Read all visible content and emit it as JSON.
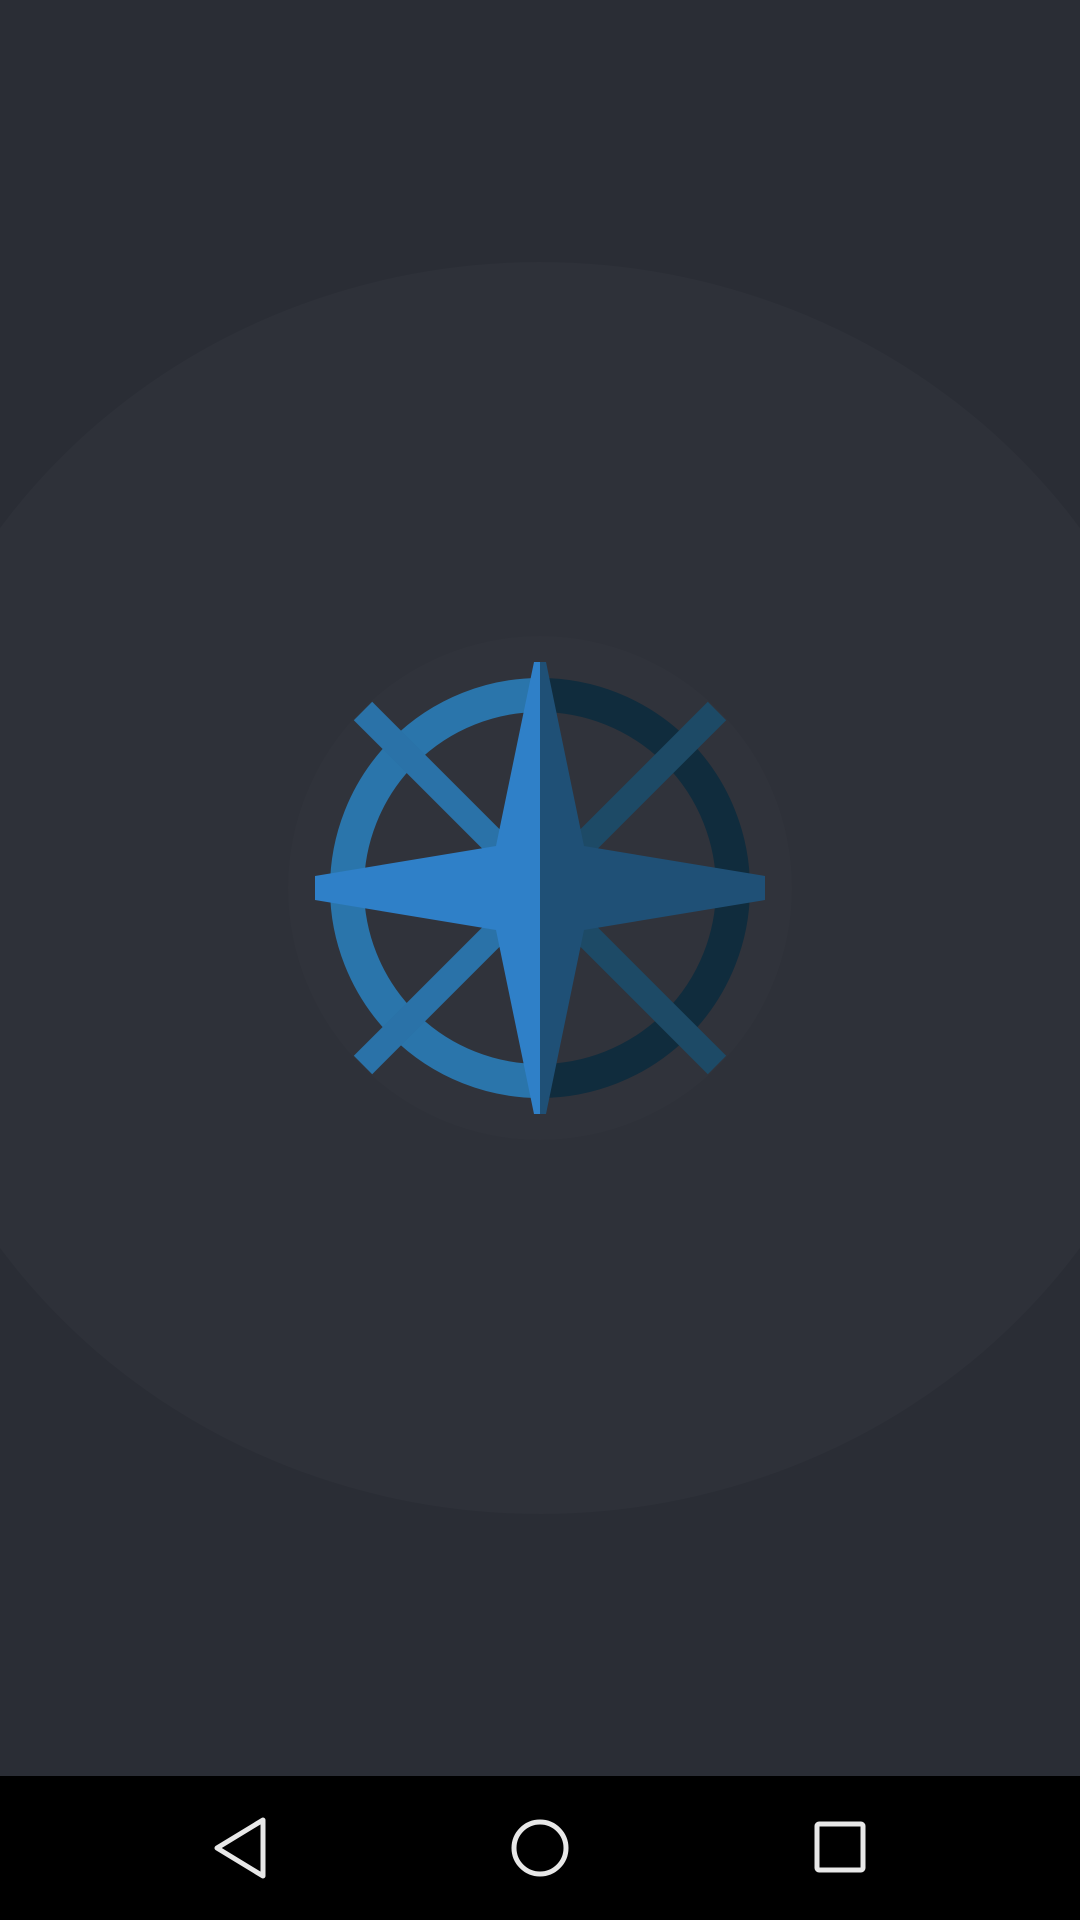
{
  "app": {
    "screen": "splash",
    "logo_icon": "compass-rose-icon"
  },
  "colors": {
    "background": "#2a2d35",
    "glow": "#2e3139",
    "logo_light_blue": "#2f80c8",
    "logo_dark_blue": "#1f5076",
    "ring_light": "#2a75ab",
    "ring_dark": "#102c3d",
    "navbar": "#000000",
    "nav_icon": "#e8e8e8"
  },
  "navbar": {
    "back_icon": "back-triangle-icon",
    "home_icon": "home-circle-icon",
    "recents_icon": "recents-square-icon"
  }
}
